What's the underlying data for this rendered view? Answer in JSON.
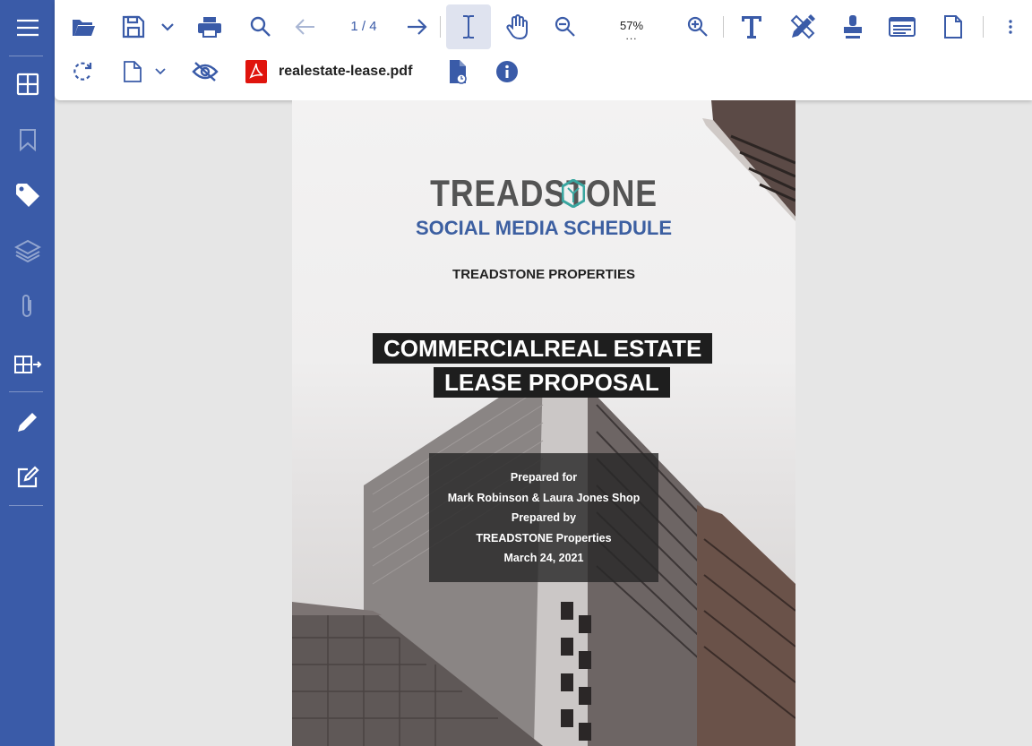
{
  "colors": {
    "sidebar": "#3a5ba8",
    "accent": "#3a5ba8",
    "pdf_red": "#e0140d",
    "subtitle": "#3c5fa1"
  },
  "sidebar": {
    "items": [
      {
        "name": "menu-icon"
      },
      {
        "name": "thumbnails-icon"
      },
      {
        "name": "bookmark-icon"
      },
      {
        "name": "tag-icon"
      },
      {
        "name": "layers-icon"
      },
      {
        "name": "paperclip-icon"
      },
      {
        "name": "organize-pages-icon"
      },
      {
        "name": "pencil-icon"
      },
      {
        "name": "edit-form-icon"
      }
    ]
  },
  "toolbar": {
    "page_indicator": "1 / 4",
    "zoom_level": "57%",
    "zoom_more": "...",
    "icons": [
      "open-folder-icon",
      "save-icon",
      "chevron-down-icon",
      "print-icon",
      "search-icon",
      "arrow-left-icon",
      "arrow-right-icon",
      "text-select-icon",
      "hand-pan-icon",
      "zoom-out-icon",
      "zoom-in-icon",
      "text-tool-icon",
      "draw-tool-icon",
      "stamp-icon",
      "form-field-icon",
      "page-icon",
      "more-vertical-icon",
      "rotate-icon",
      "page-menu-icon",
      "hide-annotations-icon",
      "pdf-file-icon",
      "document-properties-icon",
      "info-icon"
    ],
    "filename": "realestate-lease.pdf"
  },
  "document": {
    "brand": "TREADSTONE",
    "subtitle": "SOCIAL MEDIA SCHEDULE",
    "company": "TREADSTONE PROPERTIES",
    "title_line1": "COMMERCIALREAL ESTATE",
    "title_line2": "LEASE PROPOSAL",
    "info": {
      "prepared_for_label": "Prepared for",
      "prepared_for": "Mark Robinson & Laura Jones Shop",
      "prepared_by_label": "Prepared by",
      "prepared_by": "TREADSTONE Properties",
      "date": "March 24, 2021"
    }
  }
}
